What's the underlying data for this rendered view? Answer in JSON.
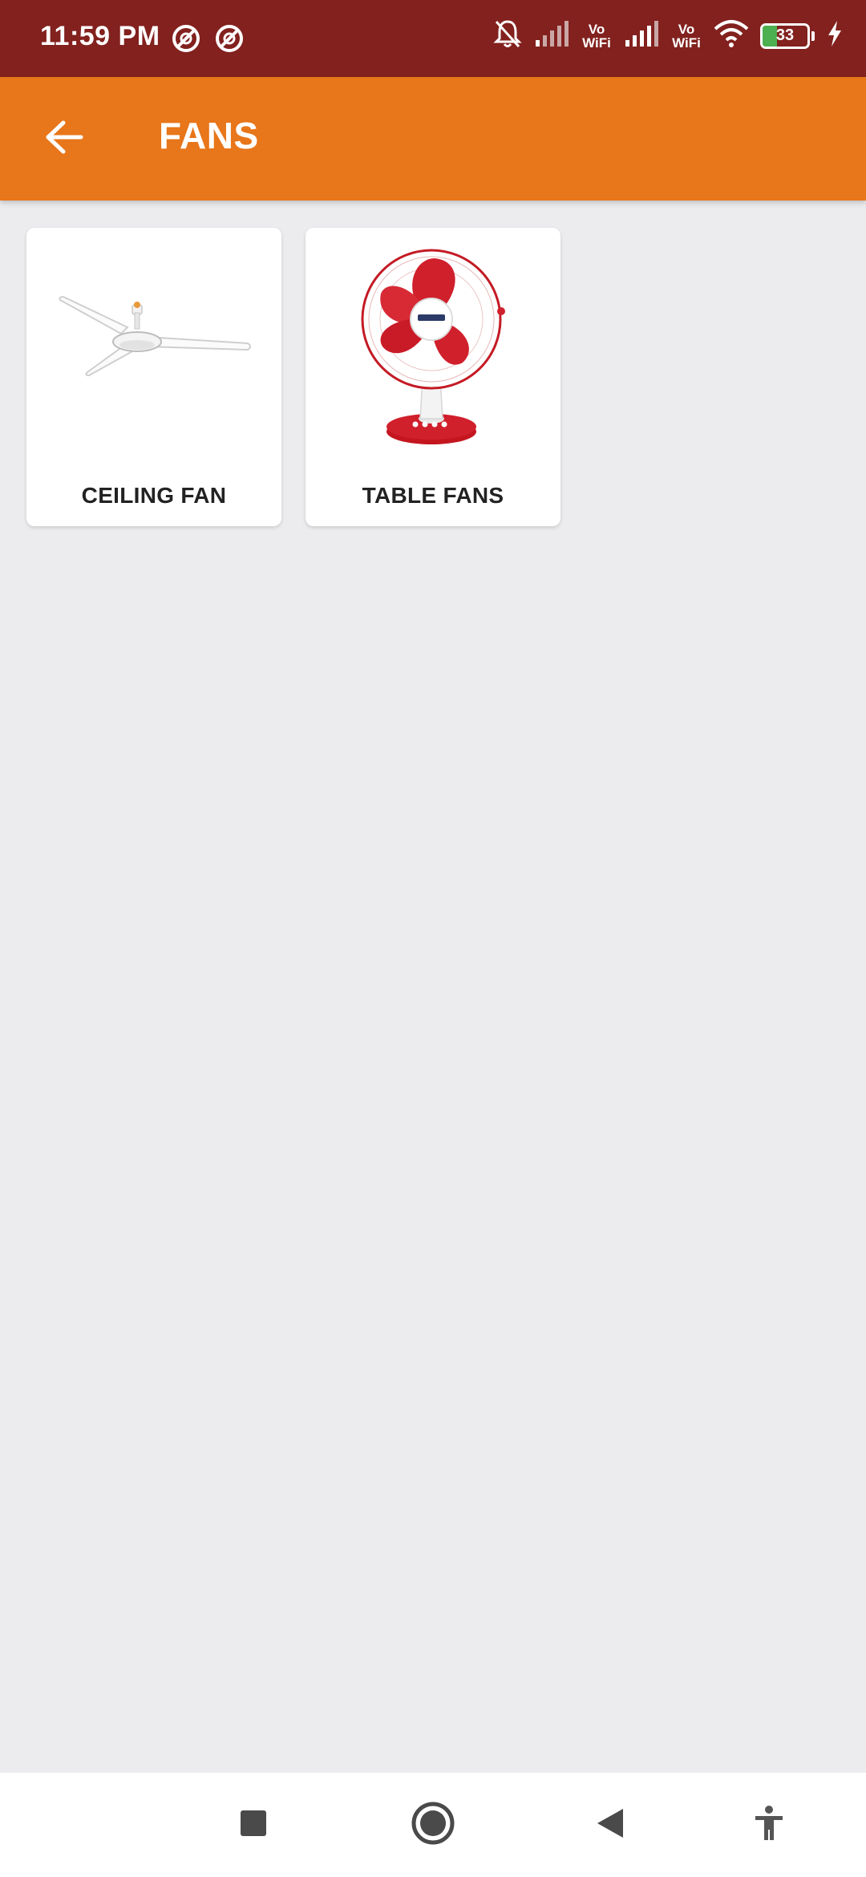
{
  "status_bar": {
    "time": "11:59 PM",
    "vowifi_1": "Vo\nWiFi",
    "vowifi_2": "Vo\nWiFi",
    "battery_percent": 33
  },
  "app_bar": {
    "title": "FANS",
    "back_icon": "arrow-left-icon"
  },
  "categories": [
    {
      "label": "CEILING FAN",
      "icon": "ceiling-fan-image"
    },
    {
      "label": "TABLE FANS",
      "icon": "table-fan-image"
    }
  ],
  "nav_bar": {
    "buttons": [
      "recents",
      "home",
      "back",
      "accessibility"
    ]
  },
  "colors": {
    "status_bar": "#82211e",
    "app_bar": "#e8761a",
    "background": "#ececee",
    "fan_red": "#d0202c"
  }
}
